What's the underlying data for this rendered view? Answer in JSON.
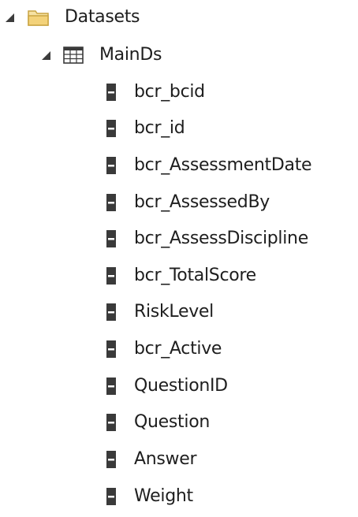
{
  "tree": {
    "root": {
      "label": "Datasets",
      "icon": "folder-icon",
      "expanded": true,
      "children": [
        {
          "label": "MainDs",
          "icon": "table-icon",
          "expanded": true,
          "fields": [
            {
              "label": "bcr_bcid",
              "icon": "field-icon"
            },
            {
              "label": "bcr_id",
              "icon": "field-icon"
            },
            {
              "label": "bcr_AssessmentDate",
              "icon": "field-icon"
            },
            {
              "label": "bcr_AssessedBy",
              "icon": "field-icon"
            },
            {
              "label": "bcr_AssessDiscipline",
              "icon": "field-icon"
            },
            {
              "label": "bcr_TotalScore",
              "icon": "field-icon"
            },
            {
              "label": "RiskLevel",
              "icon": "field-icon"
            },
            {
              "label": "bcr_Active",
              "icon": "field-icon"
            },
            {
              "label": "QuestionID",
              "icon": "field-icon"
            },
            {
              "label": "Question",
              "icon": "field-icon"
            },
            {
              "label": "Answer",
              "icon": "field-icon"
            },
            {
              "label": "Weight",
              "icon": "field-icon"
            }
          ]
        }
      ]
    }
  },
  "colors": {
    "text": "#1e1e1e",
    "expander": "#3c3c3c",
    "folder_fill": "#f3d27a",
    "folder_stroke": "#c9a443",
    "field_icon": "#3a3a3a"
  }
}
